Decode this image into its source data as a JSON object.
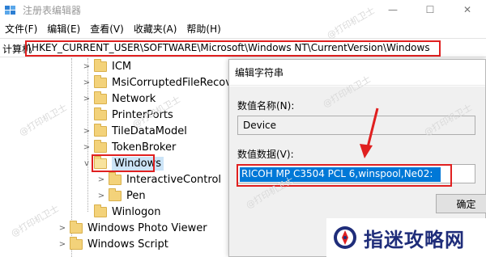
{
  "window": {
    "title": "注册表编辑器",
    "controls": {
      "minimize": "—",
      "maximize": "☐",
      "close": "✕"
    }
  },
  "menu": [
    "文件(F)",
    "编辑(E)",
    "查看(V)",
    "收藏夹(A)",
    "帮助(H)"
  ],
  "address": {
    "prefix": "计算机",
    "path": "\\HKEY_CURRENT_USER\\SOFTWARE\\Microsoft\\Windows NT\\CurrentVersion\\Windows"
  },
  "tree": {
    "items": [
      {
        "label": "ICM",
        "chev": ">",
        "indent": 1
      },
      {
        "label": "MsiCorruptedFileRecove",
        "chev": ">",
        "indent": 1
      },
      {
        "label": "Network",
        "chev": ">",
        "indent": 1
      },
      {
        "label": "PrinterPorts",
        "chev": "",
        "indent": 1
      },
      {
        "label": "TileDataModel",
        "chev": ">",
        "indent": 1
      },
      {
        "label": "TokenBroker",
        "chev": ">",
        "indent": 1
      },
      {
        "label": "Windows",
        "chev": "v",
        "indent": 1,
        "selected": true
      },
      {
        "label": "InteractiveControl",
        "chev": ">",
        "indent": 2
      },
      {
        "label": "Pen",
        "chev": ">",
        "indent": 2
      },
      {
        "label": "Winlogon",
        "chev": "",
        "indent": 1
      },
      {
        "label": "Windows Photo Viewer",
        "chev": ">",
        "indent": 0
      },
      {
        "label": "Windows Script",
        "chev": ">",
        "indent": 0
      }
    ]
  },
  "dialog": {
    "title": "编辑字符串",
    "name_label": "数值名称(N):",
    "name_value": "Device",
    "data_label": "数值数据(V):",
    "data_value": "RICOH MP C3504 PCL 6,winspool,Ne02:",
    "ok_label": "确定"
  },
  "annotation": {
    "arrow_color": "#e02020",
    "box_color": "#e02020"
  },
  "watermarks": [
    "@打印机卫士",
    "@打印机卫士",
    "@打印机卫士",
    "@打印机卫士",
    "@打印机卫士",
    "@打印机卫士",
    "@打印机卫士"
  ],
  "brand": {
    "name": "指迷攻略网"
  }
}
